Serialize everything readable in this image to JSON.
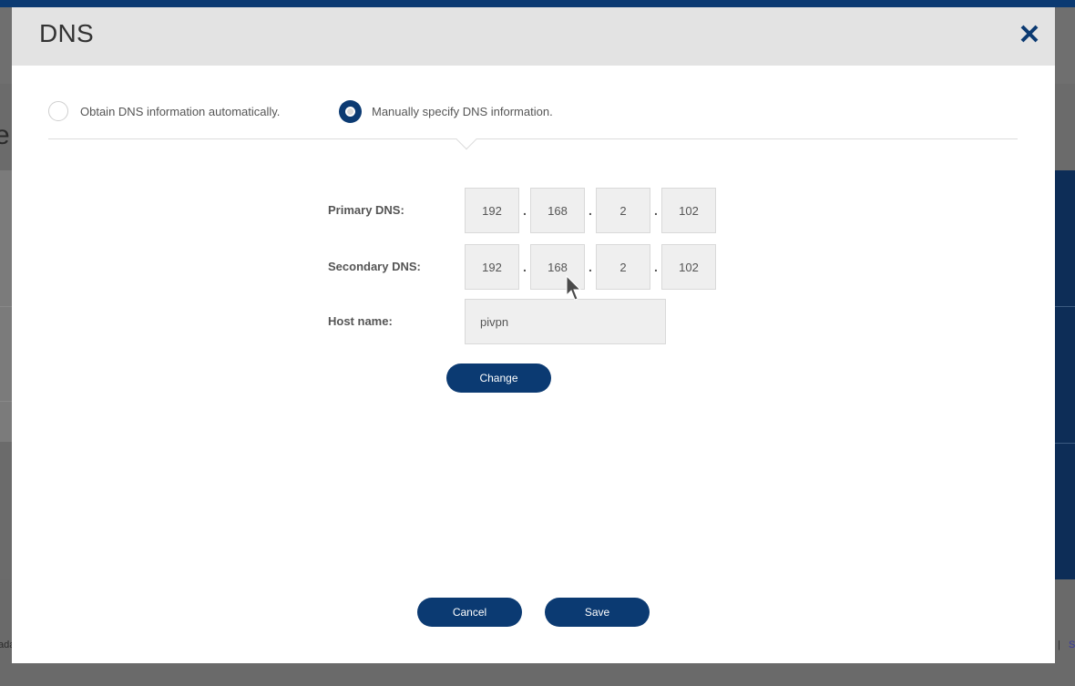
{
  "background": {
    "partial_heading": "e",
    "footer_left_fragment": "ada",
    "footer_separator": "|",
    "footer_right_fragment": "S"
  },
  "dialog": {
    "title": "DNS",
    "close_icon": "close-icon",
    "radio_options": [
      {
        "label": "Obtain DNS information automatically.",
        "selected": false
      },
      {
        "label": "Manually specify DNS information.",
        "selected": true
      }
    ],
    "primary_dns": {
      "label": "Primary DNS:",
      "octets": [
        "192",
        "168",
        "2",
        "102"
      ]
    },
    "secondary_dns": {
      "label": "Secondary DNS:",
      "octets": [
        "192",
        "168",
        "2",
        "102"
      ]
    },
    "ip_separator": ".",
    "host_name": {
      "label": "Host name:",
      "value": "pivpn"
    },
    "change_button": "Change",
    "cancel_button": "Cancel",
    "save_button": "Save"
  },
  "colors": {
    "accent": "#0b3a72",
    "header_bg": "#e3e3e3",
    "input_bg": "#efefef"
  }
}
